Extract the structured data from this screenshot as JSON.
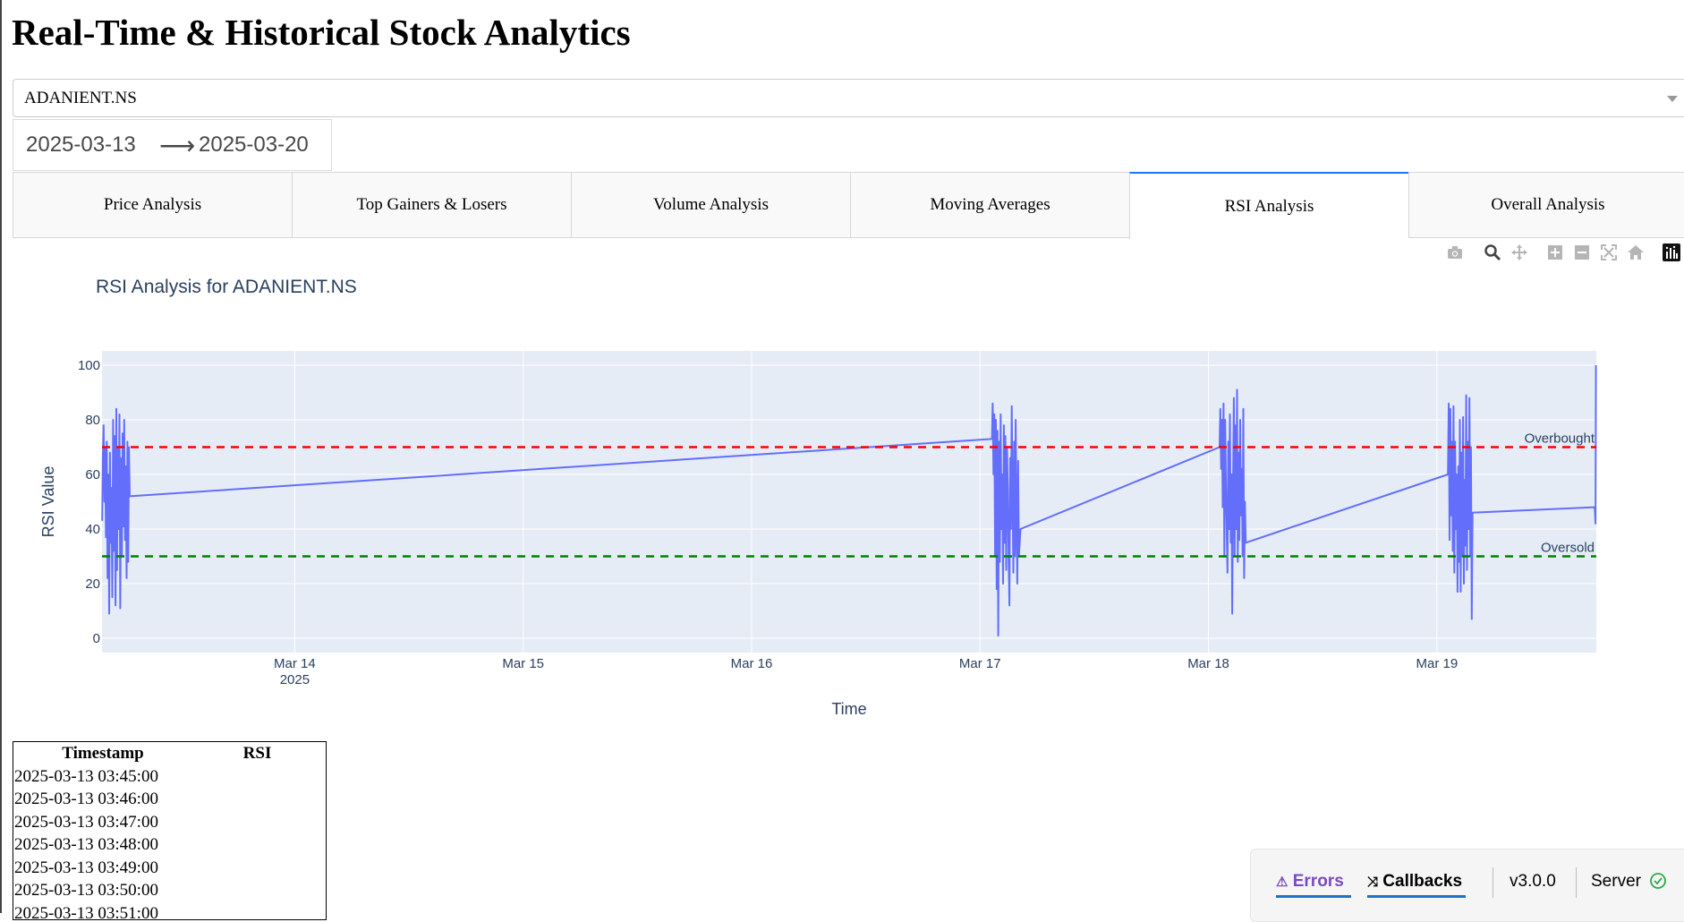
{
  "page": {
    "title": "Real-Time & Historical Stock Analytics"
  },
  "ticker_dropdown": {
    "value": "ADANIENT.NS"
  },
  "date_range": {
    "start": "2025-03-13",
    "arrow": "⟶",
    "end": "2025-03-20"
  },
  "tabs": [
    {
      "label": "Price Analysis",
      "active": false
    },
    {
      "label": "Top Gainers & Losers",
      "active": false
    },
    {
      "label": "Volume Analysis",
      "active": false
    },
    {
      "label": "Moving Averages",
      "active": false
    },
    {
      "label": "RSI Analysis",
      "active": true
    },
    {
      "label": "Overall Analysis",
      "active": false
    }
  ],
  "modebar": {
    "icons": [
      "camera-icon",
      "zoom-icon",
      "pan-icon",
      "zoom-in-icon",
      "zoom-out-icon",
      "autoscale-icon",
      "reset-axes-icon",
      "plotly-logo-icon"
    ]
  },
  "chart_data": {
    "type": "line",
    "title": "RSI Analysis for ADANIENT.NS",
    "xlabel": "Time",
    "ylabel": "RSI Value",
    "ylim": [
      0,
      100
    ],
    "y_ticks": [
      "0",
      "20",
      "40",
      "60",
      "80",
      "100"
    ],
    "x_ticks": [
      {
        "date": "2025-03-14",
        "label": "Mar 14",
        "sublabel": "2025"
      },
      {
        "date": "2025-03-15",
        "label": "Mar 15",
        "sublabel": ""
      },
      {
        "date": "2025-03-16",
        "label": "Mar 16",
        "sublabel": ""
      },
      {
        "date": "2025-03-17",
        "label": "Mar 17",
        "sublabel": ""
      },
      {
        "date": "2025-03-18",
        "label": "Mar 18",
        "sublabel": ""
      },
      {
        "date": "2025-03-19",
        "label": "Mar 19",
        "sublabel": ""
      }
    ],
    "xlim": [
      "2025-03-13 03:45",
      "2025-03-19 16:45"
    ],
    "grid": true,
    "overbought": {
      "value": 70,
      "label": "Overbought",
      "color": "#ff0000"
    },
    "oversold": {
      "value": 30,
      "label": "Oversold",
      "color": "#008000"
    },
    "series": [
      {
        "color": "#636efa",
        "points": [
          [
            "2025-03-13 03:46",
            43
          ],
          [
            "2025-03-13 03:50",
            66
          ],
          [
            "2025-03-13 03:55",
            78
          ],
          [
            "2025-03-13 04:00",
            50
          ],
          [
            "2025-03-13 04:05",
            70
          ],
          [
            "2025-03-13 04:10",
            37
          ],
          [
            "2025-03-13 04:15",
            72
          ],
          [
            "2025-03-13 04:20",
            22
          ],
          [
            "2025-03-13 04:25",
            60
          ],
          [
            "2025-03-13 04:30",
            9
          ],
          [
            "2025-03-13 04:35",
            68
          ],
          [
            "2025-03-13 04:40",
            35
          ],
          [
            "2025-03-13 04:45",
            55
          ],
          [
            "2025-03-13 04:50",
            15
          ],
          [
            "2025-03-13 04:55",
            80
          ],
          [
            "2025-03-13 05:00",
            32
          ],
          [
            "2025-03-13 05:05",
            74
          ],
          [
            "2025-03-13 05:10",
            12
          ],
          [
            "2025-03-13 05:15",
            84
          ],
          [
            "2025-03-13 05:20",
            25
          ],
          [
            "2025-03-13 05:25",
            70
          ],
          [
            "2025-03-13 05:30",
            40
          ],
          [
            "2025-03-13 05:35",
            82
          ],
          [
            "2025-03-13 05:40",
            11
          ],
          [
            "2025-03-13 05:45",
            66
          ],
          [
            "2025-03-13 05:50",
            30
          ],
          [
            "2025-03-13 05:55",
            75
          ],
          [
            "2025-03-13 06:00",
            41
          ],
          [
            "2025-03-13 06:05",
            80
          ],
          [
            "2025-03-13 06:10",
            36
          ],
          [
            "2025-03-13 06:15",
            63
          ],
          [
            "2025-03-13 06:20",
            22
          ],
          [
            "2025-03-13 06:25",
            72
          ],
          [
            "2025-03-13 06:30",
            28
          ],
          [
            "2025-03-13 06:35",
            70
          ],
          [
            "2025-03-13 06:40",
            52
          ],
          [
            "2025-03-17 01:15",
            73
          ],
          [
            "2025-03-17 01:20",
            86
          ],
          [
            "2025-03-17 01:25",
            60
          ],
          [
            "2025-03-17 01:30",
            82
          ],
          [
            "2025-03-17 01:35",
            30
          ],
          [
            "2025-03-17 01:40",
            80
          ],
          [
            "2025-03-17 01:45",
            18
          ],
          [
            "2025-03-17 01:50",
            76
          ],
          [
            "2025-03-17 01:55",
            1
          ],
          [
            "2025-03-17 02:00",
            72
          ],
          [
            "2025-03-17 02:05",
            28
          ],
          [
            "2025-03-17 02:10",
            82
          ],
          [
            "2025-03-17 02:15",
            40
          ],
          [
            "2025-03-17 02:20",
            60
          ],
          [
            "2025-03-17 02:25",
            20
          ],
          [
            "2025-03-17 02:30",
            78
          ],
          [
            "2025-03-17 02:35",
            35
          ],
          [
            "2025-03-17 02:40",
            74
          ],
          [
            "2025-03-17 02:45",
            25
          ],
          [
            "2025-03-17 02:50",
            70
          ],
          [
            "2025-03-17 02:55",
            55
          ],
          [
            "2025-03-17 03:00",
            30
          ],
          [
            "2025-03-17 03:05",
            12
          ],
          [
            "2025-03-17 03:10",
            66
          ],
          [
            "2025-03-17 03:15",
            40
          ],
          [
            "2025-03-17 03:20",
            85
          ],
          [
            "2025-03-17 03:25",
            52
          ],
          [
            "2025-03-17 03:30",
            24
          ],
          [
            "2025-03-17 03:35",
            72
          ],
          [
            "2025-03-17 03:40",
            30
          ],
          [
            "2025-03-17 03:45",
            80
          ],
          [
            "2025-03-17 03:50",
            45
          ],
          [
            "2025-03-17 03:55",
            20
          ],
          [
            "2025-03-17 04:00",
            65
          ],
          [
            "2025-03-17 04:05",
            30
          ],
          [
            "2025-03-17 04:10",
            35
          ],
          [
            "2025-03-17 04:15",
            40
          ],
          [
            "2025-03-18 01:10",
            70
          ],
          [
            "2025-03-18 01:15",
            84
          ],
          [
            "2025-03-18 01:20",
            62
          ],
          [
            "2025-03-18 01:25",
            80
          ],
          [
            "2025-03-18 01:30",
            48
          ],
          [
            "2025-03-18 01:35",
            86
          ],
          [
            "2025-03-18 01:40",
            30
          ],
          [
            "2025-03-18 01:45",
            80
          ],
          [
            "2025-03-18 01:50",
            58
          ],
          [
            "2025-03-18 02:00",
            24
          ],
          [
            "2025-03-18 02:05",
            72
          ],
          [
            "2025-03-18 02:10",
            40
          ],
          [
            "2025-03-18 02:15",
            82
          ],
          [
            "2025-03-18 02:20",
            35
          ],
          [
            "2025-03-18 02:25",
            60
          ],
          [
            "2025-03-18 02:30",
            9
          ],
          [
            "2025-03-18 02:35",
            55
          ],
          [
            "2025-03-18 02:40",
            88
          ],
          [
            "2025-03-18 02:45",
            30
          ],
          [
            "2025-03-18 02:50",
            78
          ],
          [
            "2025-03-18 02:55",
            40
          ],
          [
            "2025-03-18 03:00",
            91
          ],
          [
            "2025-03-18 03:05",
            28
          ],
          [
            "2025-03-18 03:10",
            68
          ],
          [
            "2025-03-18 03:15",
            36
          ],
          [
            "2025-03-18 03:20",
            80
          ],
          [
            "2025-03-18 03:25",
            45
          ],
          [
            "2025-03-18 03:30",
            62
          ],
          [
            "2025-03-18 03:35",
            30
          ],
          [
            "2025-03-18 03:40",
            84
          ],
          [
            "2025-03-18 03:45",
            22
          ],
          [
            "2025-03-18 03:50",
            50
          ],
          [
            "2025-03-18 03:55",
            35
          ],
          [
            "2025-03-19 01:10",
            60
          ],
          [
            "2025-03-19 01:15",
            86
          ],
          [
            "2025-03-19 01:20",
            36
          ],
          [
            "2025-03-19 01:25",
            84
          ],
          [
            "2025-03-19 01:30",
            45
          ],
          [
            "2025-03-19 01:35",
            72
          ],
          [
            "2025-03-19 01:40",
            32
          ],
          [
            "2025-03-19 01:45",
            85
          ],
          [
            "2025-03-19 01:50",
            24
          ],
          [
            "2025-03-19 01:55",
            72
          ],
          [
            "2025-03-19 02:00",
            40
          ],
          [
            "2025-03-19 02:05",
            60
          ],
          [
            "2025-03-19 02:10",
            17
          ],
          [
            "2025-03-19 02:15",
            63
          ],
          [
            "2025-03-19 02:20",
            28
          ],
          [
            "2025-03-19 02:25",
            80
          ],
          [
            "2025-03-19 02:30",
            17
          ],
          [
            "2025-03-19 02:35",
            68
          ],
          [
            "2025-03-19 02:40",
            30
          ],
          [
            "2025-03-19 02:45",
            81
          ],
          [
            "2025-03-19 02:50",
            20
          ],
          [
            "2025-03-19 02:55",
            58
          ],
          [
            "2025-03-19 03:00",
            34
          ],
          [
            "2025-03-19 03:05",
            89
          ],
          [
            "2025-03-19 03:10",
            25
          ],
          [
            "2025-03-19 03:15",
            72
          ],
          [
            "2025-03-19 03:20",
            40
          ],
          [
            "2025-03-19 03:25",
            88
          ],
          [
            "2025-03-19 03:30",
            30
          ],
          [
            "2025-03-19 03:35",
            70
          ],
          [
            "2025-03-19 03:40",
            7
          ],
          [
            "2025-03-19 03:45",
            46
          ],
          [
            "2025-03-19 16:35",
            48
          ],
          [
            "2025-03-19 16:40",
            42
          ],
          [
            "2025-03-19 16:43",
            100
          ]
        ]
      }
    ]
  },
  "rsi_table": {
    "headers": [
      "Timestamp",
      "RSI"
    ],
    "rows": [
      [
        "2025-03-13 03:45:00",
        ""
      ],
      [
        "2025-03-13 03:46:00",
        ""
      ],
      [
        "2025-03-13 03:47:00",
        ""
      ],
      [
        "2025-03-13 03:48:00",
        ""
      ],
      [
        "2025-03-13 03:49:00",
        ""
      ],
      [
        "2025-03-13 03:50:00",
        ""
      ],
      [
        "2025-03-13 03:51:00",
        ""
      ]
    ]
  },
  "debug_menu": {
    "errors_label": "Errors",
    "callbacks_label": "Callbacks",
    "version": "v3.0.0",
    "server_label": "Server",
    "accent_color": "#7a4ac2",
    "server_status_color": "#2eaa4a"
  }
}
